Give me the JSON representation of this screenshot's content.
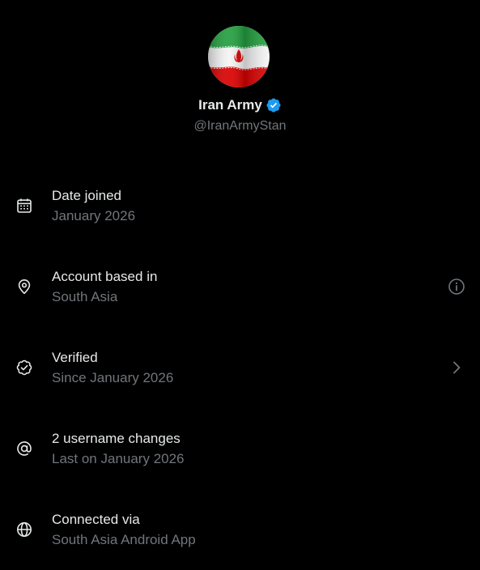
{
  "profile": {
    "display_name": "Iran Army",
    "handle": "@IranArmyStan",
    "verified": true,
    "badge_color": "#1d9bf0",
    "avatar_icon": "iran-flag-avatar"
  },
  "colors": {
    "background": "#000000",
    "primary_text": "#e7e9ea",
    "secondary_text": "#71767b",
    "accent": "#1d9bf0"
  },
  "rows": [
    {
      "icon": "calendar-icon",
      "title": "Date joined",
      "subtitle": "January 2026",
      "action": null
    },
    {
      "icon": "location-pin-icon",
      "title": "Account based in",
      "subtitle": "South Asia",
      "action": "info-icon"
    },
    {
      "icon": "verified-check-icon",
      "title": "Verified",
      "subtitle": "Since January 2026",
      "action": "chevron-right-icon"
    },
    {
      "icon": "at-sign-icon",
      "title": "2 username changes",
      "subtitle": "Last on January 2026",
      "action": null
    },
    {
      "icon": "globe-icon",
      "title": "Connected via",
      "subtitle": "South Asia Android App",
      "action": null
    }
  ]
}
